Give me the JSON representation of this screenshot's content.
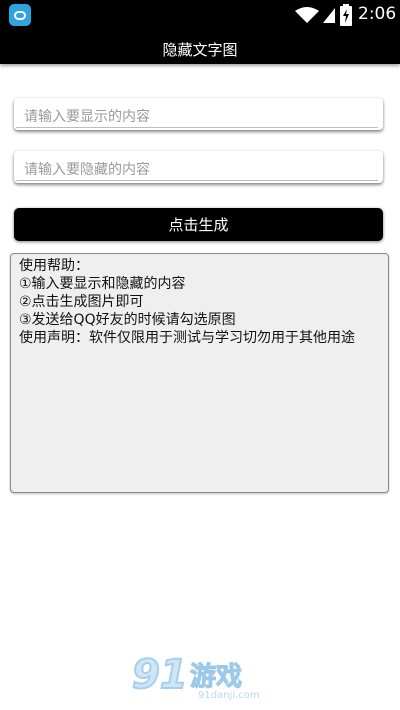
{
  "status_bar": {
    "time": "2:06",
    "icons": [
      "app-icon",
      "wifi-icon",
      "signal-icon",
      "battery-charging-icon"
    ]
  },
  "header": {
    "title": "隐藏文字图"
  },
  "form": {
    "display_placeholder": "请输入要显示的内容",
    "hidden_placeholder": "请输入要隐藏的内容",
    "display_value": "",
    "hidden_value": "",
    "generate_label": "点击生成"
  },
  "help": {
    "lines": [
      "使用帮助：",
      "①输入要显示和隐藏的内容",
      "②点击生成图片即可",
      "③发送给QQ好友的时候请勾选原图",
      "使用声明：软件仅限用于测试与学习切勿用于其他用途"
    ]
  },
  "watermark": {
    "number": "91",
    "name": "游戏",
    "url": "91danji.com"
  },
  "colors": {
    "bar": "#000000",
    "help_bg": "#efefef",
    "app_icon": "#2ea4e0",
    "watermark": "#a6cfee"
  }
}
